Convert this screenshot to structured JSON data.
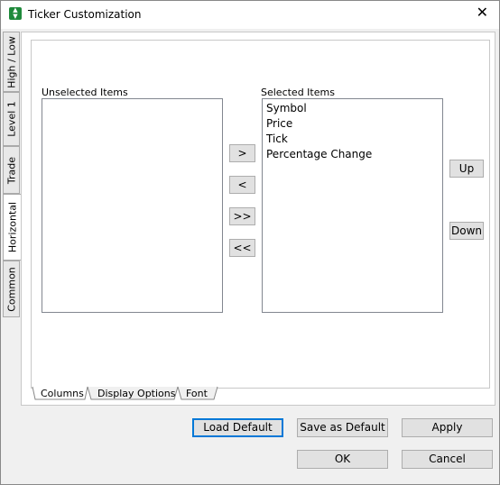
{
  "window": {
    "title": "Ticker Customization",
    "close_glyph": "✕"
  },
  "vertical_tabs": [
    "High / Low",
    "Level 1",
    "Trade",
    "Horizontal",
    "Common"
  ],
  "columns": {
    "unselected_label": "Unselected Items",
    "selected_label": "Selected Items",
    "unselected_items": [],
    "selected_items": [
      "Symbol",
      "Price",
      "Tick",
      "Percentage Change"
    ],
    "move_right": ">",
    "move_left": "<",
    "move_all_right": ">>",
    "move_all_left": "<<",
    "up": "Up",
    "down": "Down"
  },
  "bottom_tabs": [
    "Columns",
    "Display Options",
    "Font"
  ],
  "footer": {
    "load_default": "Load Default",
    "save_as_default": "Save as Default",
    "apply": "Apply",
    "ok": "OK",
    "cancel": "Cancel"
  }
}
